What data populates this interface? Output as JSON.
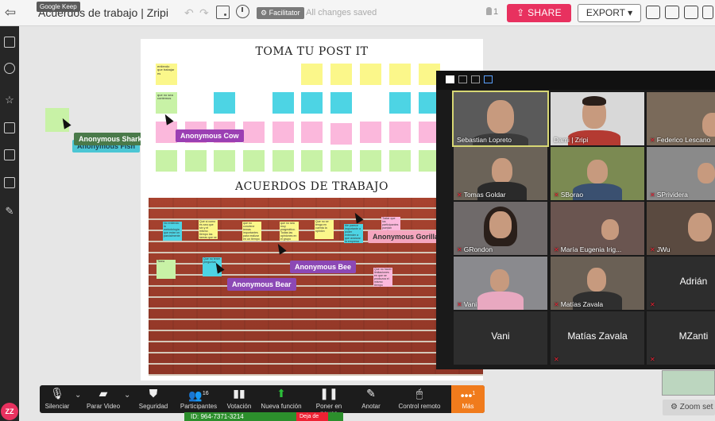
{
  "topbar": {
    "tooltip": "Google Keep",
    "board_title": "Acuerdos de trabajo | Zripi",
    "facilitator_label": "Facilitator",
    "saved_status": "All changes saved",
    "user_count": "1",
    "share_label": "SHARE",
    "export_label": "EXPORT"
  },
  "board": {
    "heading_top": "TOMA TU POST IT",
    "heading_bottom": "ACUERDOS DE TRABAJO",
    "sticky_texts": {
      "a": "entiendo que trabajar es",
      "b": "que no sea contemos",
      "c": "No entiendo la metodología que estar un parcialmente",
      "d": "Qué si como es sea que sin y el mismo tiempo las tareas que se tendrá de los participantes",
      "e": "que no conviene temas importantes para realizar en un tiempo",
      "f": "que no sea muy pragmático. Todas las opiniones en el grupo",
      "g": "Que no se tenga en cuenta la opinión",
      "h": "Me parece importante a poder entender a que avanzar la empresa",
      "i": "Tratar que los participantes puedan sentirse a gusto",
      "j": "Tarea",
      "k": "Que no tener preguntas",
      "l": "Que no hacer limitaciones en que se produzca el mismo tiempo"
    }
  },
  "cursors": {
    "shark": "Anonymous Shark",
    "fish": "Anonymous Fish",
    "cow": "Anonymous Cow",
    "gorilla": "Anonymous Gorilla",
    "bee": "Anonymous Bee",
    "bear": "Anonymous Bear"
  },
  "zoom": {
    "participants": [
      {
        "name": "Sebastian Lopreto"
      },
      {
        "name": "Dami | Zripi"
      },
      {
        "name": "Federico Lescano"
      },
      {
        "name": "Tomas Goldar"
      },
      {
        "name": "SBorao"
      },
      {
        "name": "SPrividera"
      },
      {
        "name": "GRondon"
      },
      {
        "name": "María Eugenia Irig..."
      },
      {
        "name": "JWu"
      },
      {
        "name": "Vani"
      },
      {
        "name": "Matías Zavala"
      },
      {
        "name": "Adrián"
      },
      {
        "name": "Vani"
      },
      {
        "name": "Matías Zavala"
      },
      {
        "name": "MZanti"
      }
    ],
    "toolbar": {
      "mute": "Silenciar",
      "video": "Parar Video",
      "security": "Seguridad",
      "participants": "Participantes",
      "participants_count": "16",
      "polling": "Votación",
      "new_feature": "Nueva función",
      "pause": "Poner en pausa",
      "annotate": "Anotar",
      "remote": "Control remoto",
      "more": "Más",
      "more_count": "1"
    },
    "meeting_id": "ID: 964-7371-3214",
    "stop_share": "Deja de",
    "zoom_settings": "Zoom set"
  },
  "avatar_initials": "ZZ",
  "colors": {
    "share": "#e8315f",
    "more": "#f07b1c",
    "sticky_yellow": "#fbf78a",
    "sticky_cyan": "#4dd4e4",
    "sticky_pink": "#fbb8dc",
    "sticky_green": "#c8f2a6"
  }
}
